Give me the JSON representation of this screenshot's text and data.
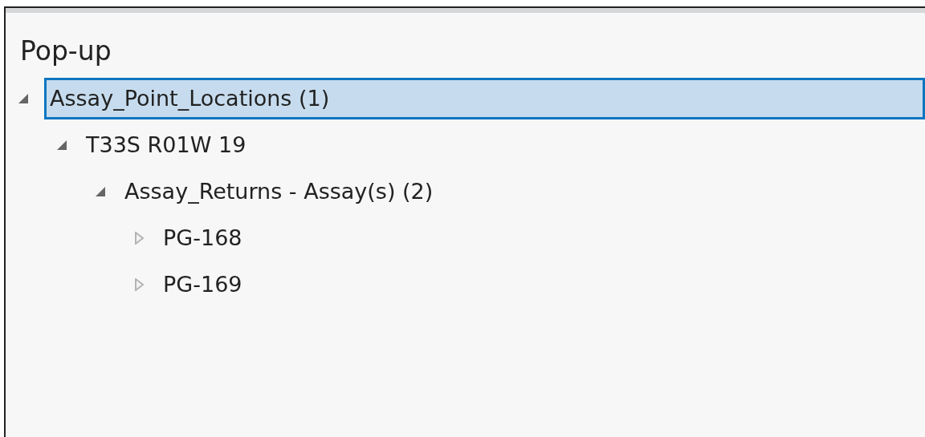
{
  "panel": {
    "title": "Pop-up"
  },
  "tree": [
    {
      "label": "Assay_Point_Locations (1)",
      "expanded": true,
      "selected": true,
      "children": [
        {
          "label": "T33S R01W 19",
          "expanded": true,
          "selected": false,
          "children": [
            {
              "label": "Assay_Returns - Assay(s) (2)",
              "expanded": true,
              "selected": false,
              "children": [
                {
                  "label": "PG-168",
                  "expanded": false,
                  "selected": false
                },
                {
                  "label": "PG-169",
                  "expanded": false,
                  "selected": false
                }
              ]
            }
          ]
        }
      ]
    }
  ]
}
